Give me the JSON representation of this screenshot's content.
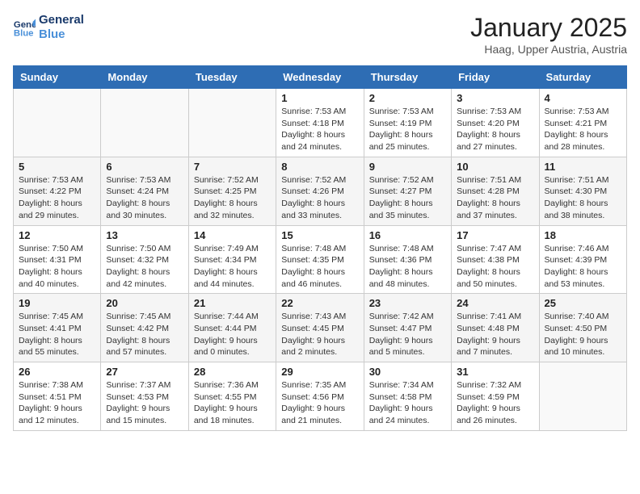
{
  "logo": {
    "line1": "General",
    "line2": "Blue"
  },
  "title": "January 2025",
  "location": "Haag, Upper Austria, Austria",
  "days_of_week": [
    "Sunday",
    "Monday",
    "Tuesday",
    "Wednesday",
    "Thursday",
    "Friday",
    "Saturday"
  ],
  "weeks": [
    [
      {
        "day": "",
        "info": ""
      },
      {
        "day": "",
        "info": ""
      },
      {
        "day": "",
        "info": ""
      },
      {
        "day": "1",
        "info": "Sunrise: 7:53 AM\nSunset: 4:18 PM\nDaylight: 8 hours\nand 24 minutes."
      },
      {
        "day": "2",
        "info": "Sunrise: 7:53 AM\nSunset: 4:19 PM\nDaylight: 8 hours\nand 25 minutes."
      },
      {
        "day": "3",
        "info": "Sunrise: 7:53 AM\nSunset: 4:20 PM\nDaylight: 8 hours\nand 27 minutes."
      },
      {
        "day": "4",
        "info": "Sunrise: 7:53 AM\nSunset: 4:21 PM\nDaylight: 8 hours\nand 28 minutes."
      }
    ],
    [
      {
        "day": "5",
        "info": "Sunrise: 7:53 AM\nSunset: 4:22 PM\nDaylight: 8 hours\nand 29 minutes."
      },
      {
        "day": "6",
        "info": "Sunrise: 7:53 AM\nSunset: 4:24 PM\nDaylight: 8 hours\nand 30 minutes."
      },
      {
        "day": "7",
        "info": "Sunrise: 7:52 AM\nSunset: 4:25 PM\nDaylight: 8 hours\nand 32 minutes."
      },
      {
        "day": "8",
        "info": "Sunrise: 7:52 AM\nSunset: 4:26 PM\nDaylight: 8 hours\nand 33 minutes."
      },
      {
        "day": "9",
        "info": "Sunrise: 7:52 AM\nSunset: 4:27 PM\nDaylight: 8 hours\nand 35 minutes."
      },
      {
        "day": "10",
        "info": "Sunrise: 7:51 AM\nSunset: 4:28 PM\nDaylight: 8 hours\nand 37 minutes."
      },
      {
        "day": "11",
        "info": "Sunrise: 7:51 AM\nSunset: 4:30 PM\nDaylight: 8 hours\nand 38 minutes."
      }
    ],
    [
      {
        "day": "12",
        "info": "Sunrise: 7:50 AM\nSunset: 4:31 PM\nDaylight: 8 hours\nand 40 minutes."
      },
      {
        "day": "13",
        "info": "Sunrise: 7:50 AM\nSunset: 4:32 PM\nDaylight: 8 hours\nand 42 minutes."
      },
      {
        "day": "14",
        "info": "Sunrise: 7:49 AM\nSunset: 4:34 PM\nDaylight: 8 hours\nand 44 minutes."
      },
      {
        "day": "15",
        "info": "Sunrise: 7:48 AM\nSunset: 4:35 PM\nDaylight: 8 hours\nand 46 minutes."
      },
      {
        "day": "16",
        "info": "Sunrise: 7:48 AM\nSunset: 4:36 PM\nDaylight: 8 hours\nand 48 minutes."
      },
      {
        "day": "17",
        "info": "Sunrise: 7:47 AM\nSunset: 4:38 PM\nDaylight: 8 hours\nand 50 minutes."
      },
      {
        "day": "18",
        "info": "Sunrise: 7:46 AM\nSunset: 4:39 PM\nDaylight: 8 hours\nand 53 minutes."
      }
    ],
    [
      {
        "day": "19",
        "info": "Sunrise: 7:45 AM\nSunset: 4:41 PM\nDaylight: 8 hours\nand 55 minutes."
      },
      {
        "day": "20",
        "info": "Sunrise: 7:45 AM\nSunset: 4:42 PM\nDaylight: 8 hours\nand 57 minutes."
      },
      {
        "day": "21",
        "info": "Sunrise: 7:44 AM\nSunset: 4:44 PM\nDaylight: 9 hours\nand 0 minutes."
      },
      {
        "day": "22",
        "info": "Sunrise: 7:43 AM\nSunset: 4:45 PM\nDaylight: 9 hours\nand 2 minutes."
      },
      {
        "day": "23",
        "info": "Sunrise: 7:42 AM\nSunset: 4:47 PM\nDaylight: 9 hours\nand 5 minutes."
      },
      {
        "day": "24",
        "info": "Sunrise: 7:41 AM\nSunset: 4:48 PM\nDaylight: 9 hours\nand 7 minutes."
      },
      {
        "day": "25",
        "info": "Sunrise: 7:40 AM\nSunset: 4:50 PM\nDaylight: 9 hours\nand 10 minutes."
      }
    ],
    [
      {
        "day": "26",
        "info": "Sunrise: 7:38 AM\nSunset: 4:51 PM\nDaylight: 9 hours\nand 12 minutes."
      },
      {
        "day": "27",
        "info": "Sunrise: 7:37 AM\nSunset: 4:53 PM\nDaylight: 9 hours\nand 15 minutes."
      },
      {
        "day": "28",
        "info": "Sunrise: 7:36 AM\nSunset: 4:55 PM\nDaylight: 9 hours\nand 18 minutes."
      },
      {
        "day": "29",
        "info": "Sunrise: 7:35 AM\nSunset: 4:56 PM\nDaylight: 9 hours\nand 21 minutes."
      },
      {
        "day": "30",
        "info": "Sunrise: 7:34 AM\nSunset: 4:58 PM\nDaylight: 9 hours\nand 24 minutes."
      },
      {
        "day": "31",
        "info": "Sunrise: 7:32 AM\nSunset: 4:59 PM\nDaylight: 9 hours\nand 26 minutes."
      },
      {
        "day": "",
        "info": ""
      }
    ]
  ]
}
